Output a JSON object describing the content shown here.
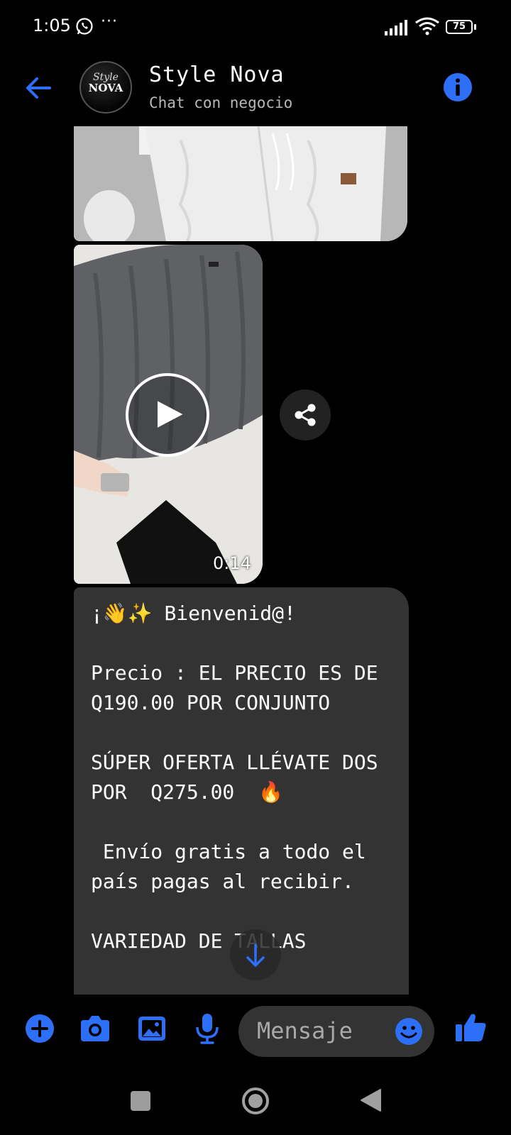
{
  "status_bar": {
    "time": "1:05",
    "more": "···",
    "battery": "75"
  },
  "header": {
    "title": "Style Nova",
    "subtitle": "Chat con negocio",
    "avatar_line1": "Style",
    "avatar_line2": "NOVA"
  },
  "video": {
    "duration": "0:14"
  },
  "message": {
    "text": "¡👋✨ Bienvenid@!\n\nPrecio : EL PRECIO ES DE Q190.00 POR CONJUNTO\n\nSÚPER OFERTA LLÉVATE DOS POR  Q275.00  🔥\n\n Envío gratis a todo el país pagas al recibir.\n\nVARIEDAD DE TALLAS"
  },
  "composer": {
    "placeholder": "Mensaje"
  },
  "colors": {
    "accent": "#2d6ff7",
    "bubble": "#333333",
    "background": "#000000"
  },
  "icons": [
    "back-arrow-icon",
    "info-icon",
    "play-icon",
    "share-icon",
    "arrow-down-icon",
    "plus-icon",
    "camera-icon",
    "gallery-icon",
    "microphone-icon",
    "emoji-icon",
    "thumbs-up-icon"
  ]
}
